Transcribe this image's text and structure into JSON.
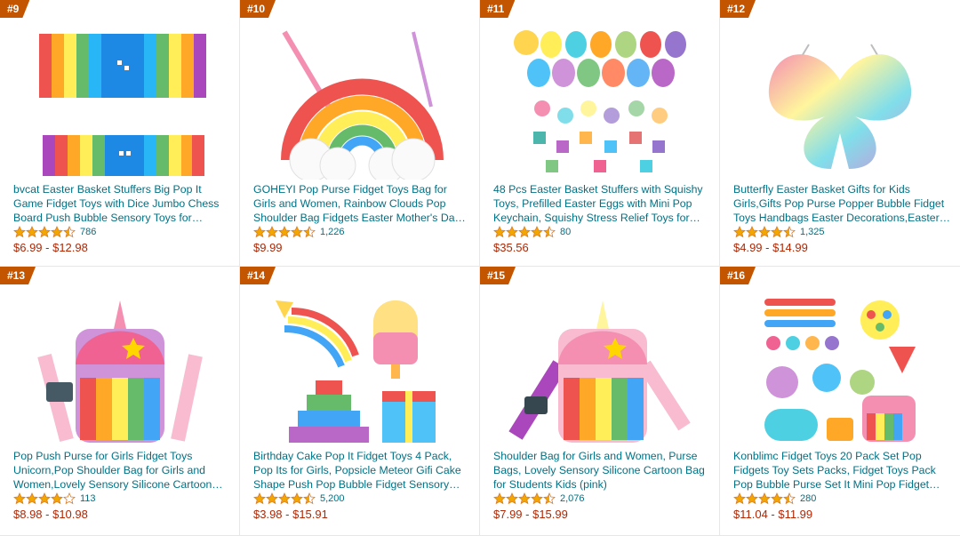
{
  "colors": {
    "rank_bg": "#c45500",
    "link": "#007185",
    "price": "#b12704",
    "star": "#f2a600"
  },
  "products": [
    {
      "rank": "#9",
      "title": "bvcat Easter Basket Stuffers Big Pop It Game Fidget Toys with Dice Jumbo Chess Board Push Bubble Sensory Toys for Parent-Child Time…",
      "rating": 4.5,
      "reviews": "786",
      "price": "$6.99 - $12.98",
      "image": "rainbow-chess-board-pop-it"
    },
    {
      "rank": "#10",
      "title": "GOHEYI Pop Purse Fidget Toys Bag for Girls and Women, Rainbow Clouds Pop Shoulder Bag Fidgets Easter Mother's Day Party Favor,…",
      "rating": 4.5,
      "reviews": "1,226",
      "price": "$9.99",
      "image": "rainbow-cloud-purse"
    },
    {
      "rank": "#11",
      "title": "48 Pcs Easter Basket Stuffers with Squishy Toys, Prefilled Easter Eggs with Mini Pop Keychain, Squishy Stress Relief Toys for East…",
      "rating": 4.5,
      "reviews": "80",
      "price": "$35.56",
      "image": "easter-eggs-squishy"
    },
    {
      "rank": "#12",
      "title": "Butterfly Easter Basket Gifts for Kids Girls,Gifts Pop Purse Popper Bubble Fidget Toys Handbags Easter Decorations,Easter Basket…",
      "rating": 4.5,
      "reviews": "1,325",
      "price": "$4.99 - $14.99",
      "image": "butterfly-purse"
    },
    {
      "rank": "#13",
      "title": "Pop Push Purse for Girls Fidget Toys Unicorn,Pop Shoulder Bag for Girls and Women,Lovely Sensory Silicone Cartoon Bag…",
      "rating": 4.0,
      "reviews": "113",
      "price": "$8.98 - $10.98",
      "image": "unicorn-bag"
    },
    {
      "rank": "#14",
      "title": "Birthday Cake Pop It Fidget Toys 4 Pack, Pop Its for Girls, Popsicle Meteor Gifi Cake Shape Push Pop Bubble Fidget Sensory Toys Set.",
      "rating": 4.5,
      "reviews": "5,200",
      "price": "$3.98 - $15.91",
      "image": "cake-popsicle-pack"
    },
    {
      "rank": "#15",
      "title": "Shoulder Bag for Girls and Women, Purse Bags, Lovely Sensory Silicone Cartoon Bag for Students Kids (pink)",
      "rating": 4.5,
      "reviews": "2,076",
      "price": "$7.99 - $15.99",
      "image": "unicorn-bag-pink"
    },
    {
      "rank": "#16",
      "title": "Konblimc Fidget Toys 20 Pack Set Pop Fidgets Toy Sets Packs, Fidget Toys Pack Pop Bubble Purse Set It Mini Pop Fidget Spinners, Stress…",
      "rating": 4.5,
      "reviews": "280",
      "price": "$11.04 - $11.99",
      "image": "fidget-toy-set"
    }
  ]
}
